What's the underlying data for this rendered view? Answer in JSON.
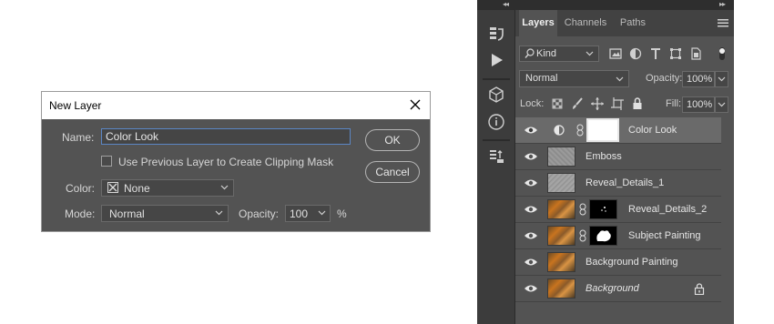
{
  "dialog": {
    "title": "New Layer",
    "name_label": "Name:",
    "name_value": "Color Look",
    "clip_label": "Use Previous Layer to Create Clipping Mask",
    "clip_checked": false,
    "color_label": "Color:",
    "color_value": "None",
    "mode_label": "Mode:",
    "mode_value": "Normal",
    "opacity_label": "Opacity:",
    "opacity_value": "100",
    "opacity_unit": "%",
    "ok_label": "OK",
    "cancel_label": "Cancel"
  },
  "panel": {
    "tabs": [
      "Layers",
      "Channels",
      "Paths"
    ],
    "active_tab": "Layers",
    "filter_kind": "Kind",
    "blend_mode": "Normal",
    "opacity_label": "Opacity:",
    "opacity_value": "100%",
    "lock_label": "Lock:",
    "fill_label": "Fill:",
    "fill_value": "100%",
    "layers": [
      {
        "name": "Color Look",
        "type": "adjustment",
        "selected": true
      },
      {
        "name": "Emboss",
        "type": "pixel"
      },
      {
        "name": "Reveal_Details_1",
        "type": "pixel"
      },
      {
        "name": "Reveal_Details_2",
        "type": "masked"
      },
      {
        "name": "Subject Painting",
        "type": "masked"
      },
      {
        "name": "Background Painting",
        "type": "pixel"
      },
      {
        "name": "Background",
        "type": "background",
        "locked": true
      }
    ]
  },
  "colors": {
    "dialog_bg": "#535353",
    "panel_bg": "#535353",
    "selected_row": "#6a6a6a",
    "focus_border": "#5b86c4"
  }
}
